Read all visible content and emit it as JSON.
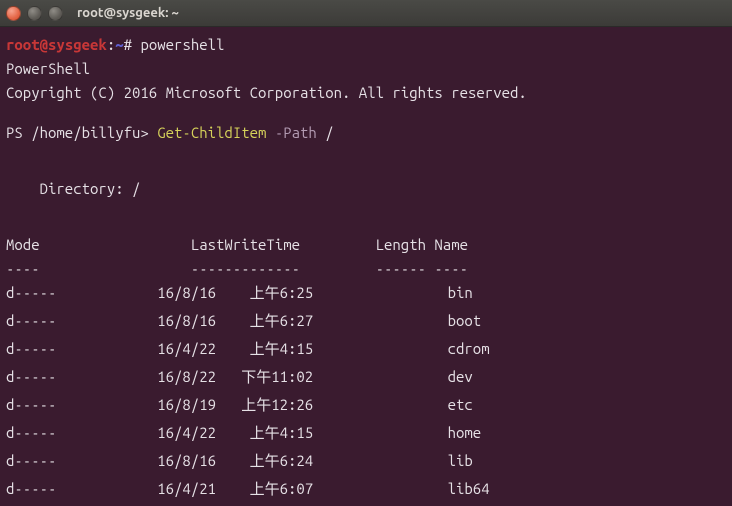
{
  "window": {
    "title": "root@sysgeek: ~"
  },
  "shell": {
    "user": "root",
    "host": "sysgeek",
    "cwd": "~",
    "symbol": "#",
    "command": "powershell"
  },
  "banner": {
    "line1": "PowerShell",
    "line2": "Copyright (C) 2016 Microsoft Corporation. All rights reserved."
  },
  "ps": {
    "prompt": "PS /home/billyfu>",
    "cmdlet": "Get-ChildItem",
    "param": "-Path",
    "arg": "/"
  },
  "dir_header": "    Directory: /",
  "columns": {
    "mode": "Mode",
    "lwt": "LastWriteTime",
    "length": "Length",
    "name": "Name"
  },
  "dashes": {
    "mode": "----",
    "lwt": "-------------",
    "length": "------",
    "name": "----"
  },
  "rows": [
    {
      "mode": "d-----",
      "date": "16/8/16",
      "time": "上午6:25",
      "length": "",
      "name": "bin"
    },
    {
      "mode": "d-----",
      "date": "16/8/16",
      "time": "上午6:27",
      "length": "",
      "name": "boot"
    },
    {
      "mode": "d-----",
      "date": "16/4/22",
      "time": "上午4:15",
      "length": "",
      "name": "cdrom"
    },
    {
      "mode": "d-----",
      "date": "16/8/22",
      "time": "下午11:02",
      "length": "",
      "name": "dev"
    },
    {
      "mode": "d-----",
      "date": "16/8/19",
      "time": "上午12:26",
      "length": "",
      "name": "etc"
    },
    {
      "mode": "d-----",
      "date": "16/4/22",
      "time": "上午4:15",
      "length": "",
      "name": "home"
    },
    {
      "mode": "d-----",
      "date": "16/8/16",
      "time": "上午6:24",
      "length": "",
      "name": "lib"
    },
    {
      "mode": "d-----",
      "date": "16/4/21",
      "time": "上午6:07",
      "length": "",
      "name": "lib64"
    }
  ]
}
